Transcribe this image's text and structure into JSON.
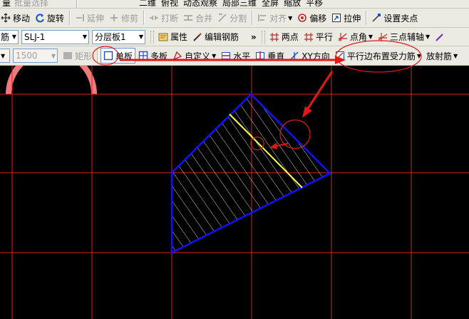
{
  "toolbar1": {
    "items": [
      "量",
      "批量选择",
      "二维",
      "俯视",
      "动态观察",
      "局部三维",
      "全屏",
      "缩放",
      "平移"
    ]
  },
  "toolbar2": {
    "move": "移动",
    "rotate": "旋转",
    "extend": "延伸",
    "trim": "修剪",
    "break": "打断",
    "merge": "合并",
    "split": "分割",
    "align": "对齐",
    "offset": "偏移",
    "stretch": "拉伸",
    "set_grip": "设置夹点"
  },
  "toolbar3": {
    "category_value": "筋",
    "element_value": "SLJ-1",
    "layer_value": "分层板1",
    "properties": "属性",
    "edit_rebar": "编辑钢筋",
    "more": "»",
    "two_points": "两点",
    "parallel": "平行",
    "point_angle": "点角",
    "three_point_axis": "三点辅轴"
  },
  "toolbar4": {
    "disabled_value": "1500",
    "rectangle": "矩形",
    "single_slab": "单板",
    "multi_slab": "多板",
    "custom": "自定义",
    "horizontal": "水平",
    "vertical": "垂直",
    "xy_direction": "XY方向",
    "parallel_edge_rebar": "平行边布置受力筋",
    "radial_rebar": "放射筋"
  },
  "colors": {
    "grid": "#e0202a",
    "slab_outline": "#1010ff",
    "rebar": "#ffff40",
    "annotation": "#e21818",
    "hatch": "#ffffff"
  }
}
